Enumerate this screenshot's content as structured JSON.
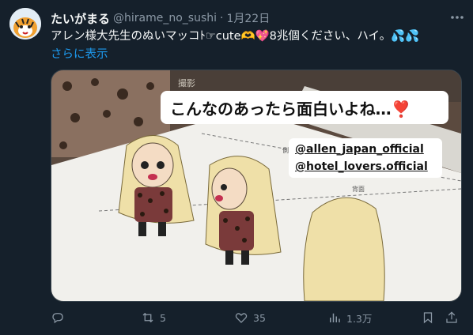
{
  "tweet": {
    "display_name": "たいがまる",
    "handle": "@hirame_no_sushi",
    "separator": "·",
    "time": "1月22日",
    "text": "アレン様大先生のぬいマッコﾄ☞cute🫶💖8兆個ください、ハイ。💦💦",
    "show_more": "さらに表示"
  },
  "media": {
    "overlay_main": "こんなのあったら面白いよね…❣️",
    "overlay_tags": [
      "@allen_japan_official",
      "@hotel_lovers.official"
    ],
    "paper_labels": {
      "side": "側面",
      "back": "背面",
      "top": "撮影"
    }
  },
  "actions": {
    "reply_count": "",
    "retweet_count": "5",
    "like_count": "35",
    "view_count": "1.3万"
  },
  "colors": {
    "background": "#15202b",
    "link": "#1d9bf0",
    "muted": "#8b98a5"
  },
  "icons": [
    "more-icon",
    "reply-icon",
    "retweet-icon",
    "like-icon",
    "views-icon",
    "bookmark-icon",
    "share-icon"
  ]
}
